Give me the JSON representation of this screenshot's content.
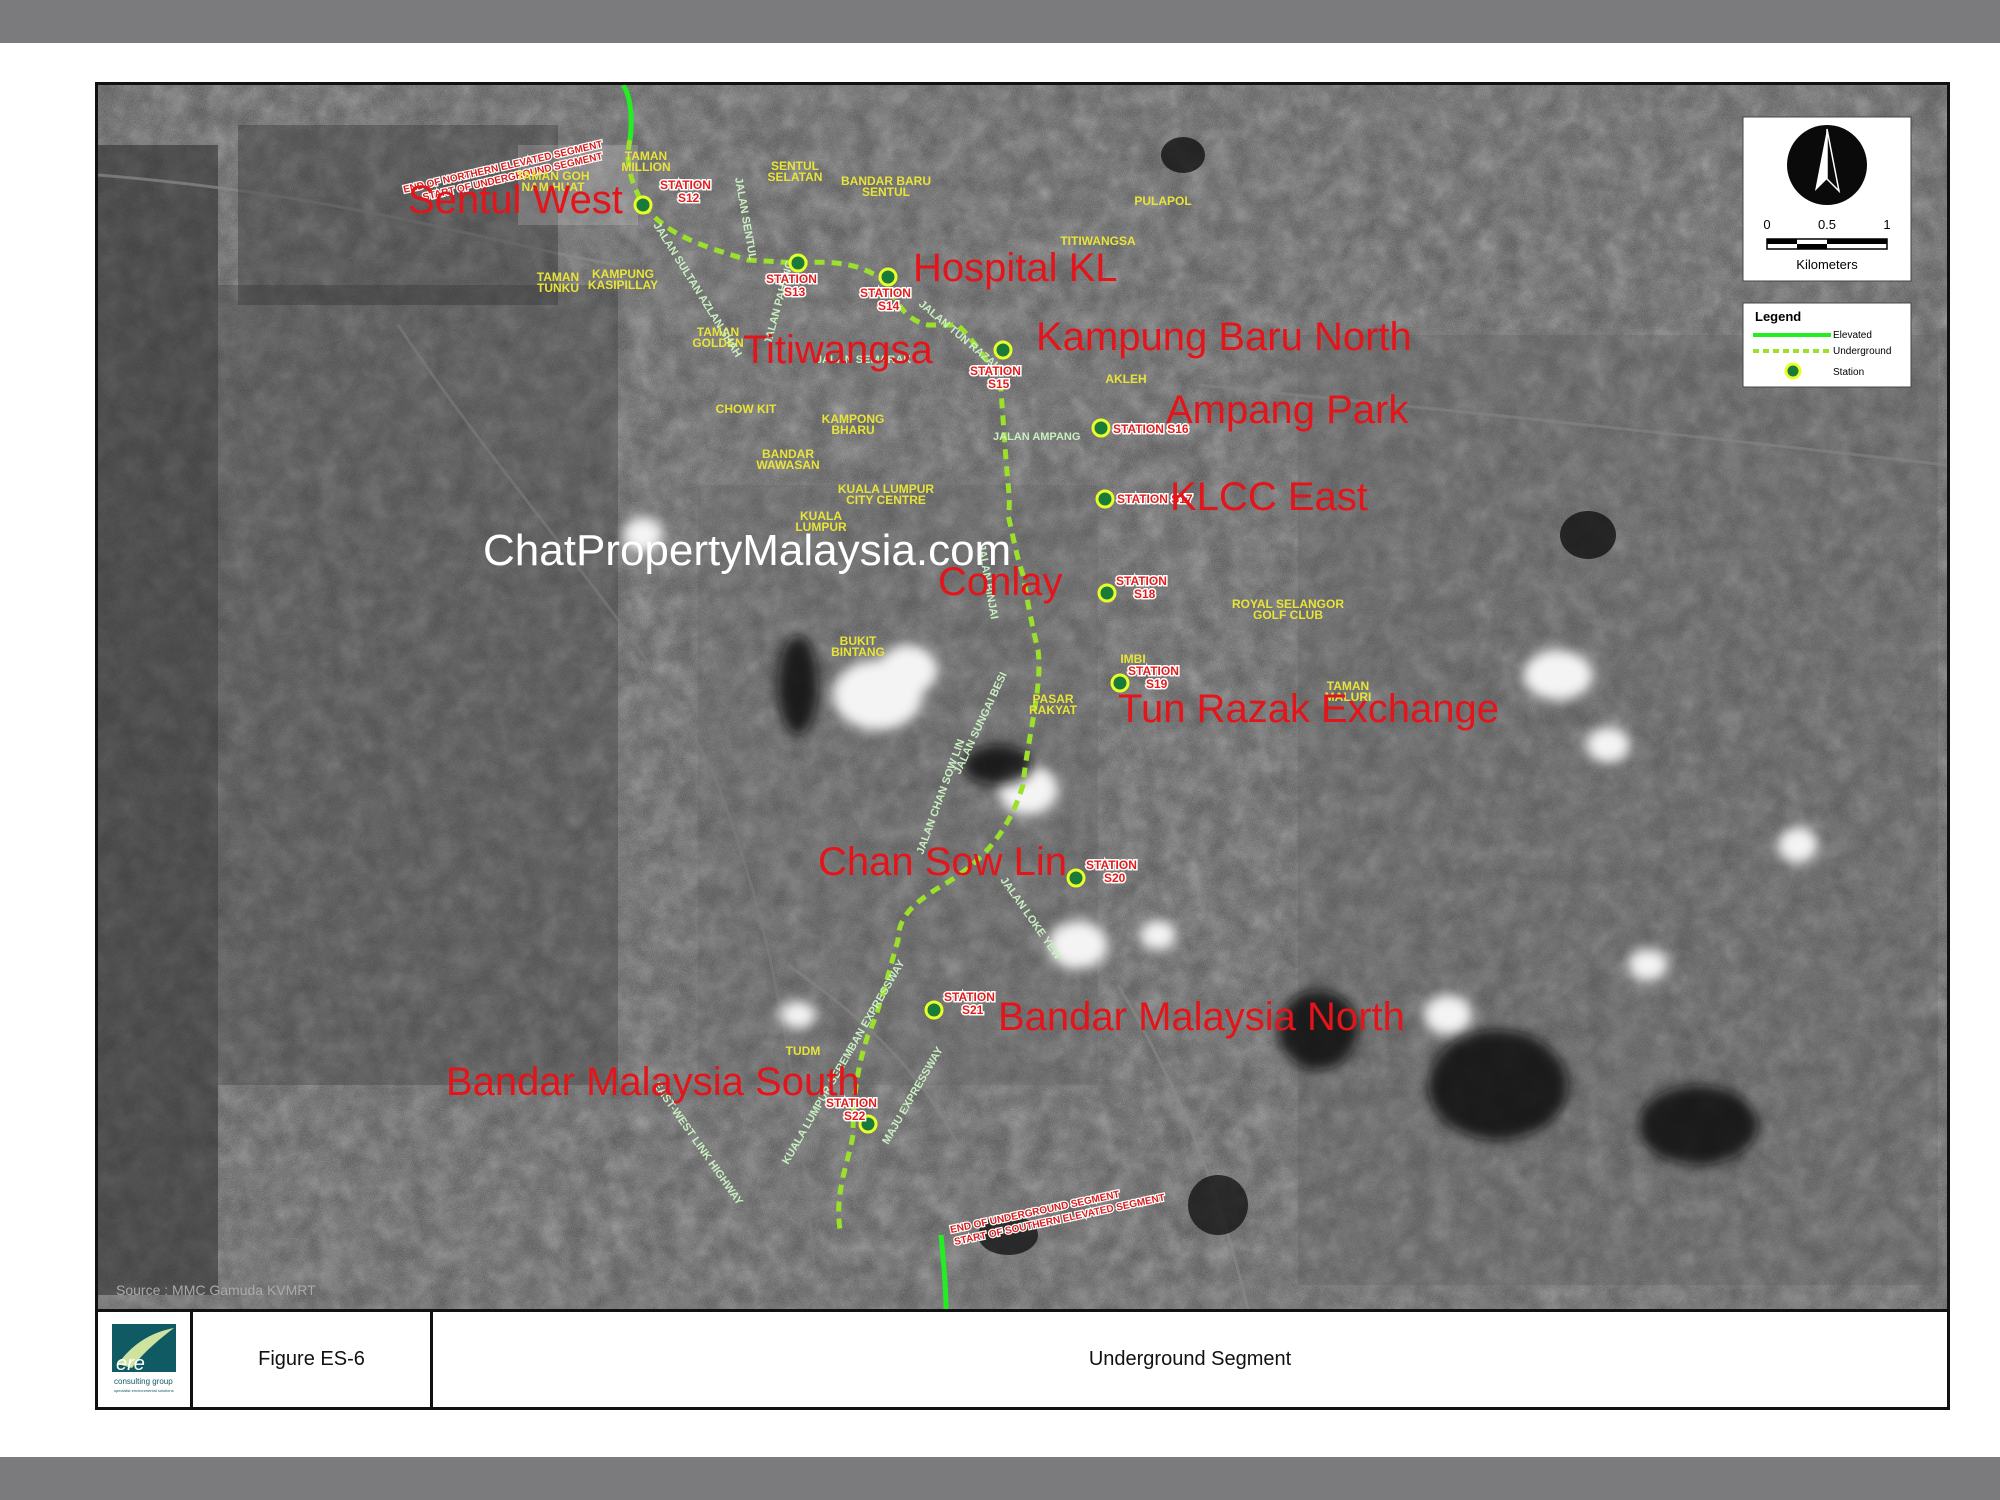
{
  "figure": {
    "number": "Figure ES-6",
    "title": "Underground Segment"
  },
  "logo": {
    "name": "ere",
    "tagline": "consulting group",
    "sub": "specialist environmental solutions"
  },
  "watermark": "ChatPropertyMalaysia.com",
  "source": "Source : MMC Gamuda KVMRT",
  "colors": {
    "elevated": "#22ee22",
    "underground": "#9be02a",
    "station_fill": "#1a7a3a",
    "station_ring": "#e8ff2a",
    "station_label": "#e31b1b",
    "area_label": "#e8e43a",
    "road_label": "#c9f0c0",
    "name_label": "#e3141a"
  },
  "north_arrow": {
    "scale_ticks": [
      "0",
      "0.5",
      "1"
    ],
    "unit": "Kilometers"
  },
  "legend": {
    "title": "Legend",
    "items": [
      {
        "label": "Elevated",
        "symbol": "solid-line"
      },
      {
        "label": "Underground",
        "symbol": "dashed-line"
      },
      {
        "label": "Station",
        "symbol": "circle"
      }
    ]
  },
  "segment_notes": {
    "north": [
      "END OF NORTHERN ELEVATED SEGMENT",
      "START OF UNDERGROUND SEGMENT"
    ],
    "south": [
      "END OF UNDERGROUND SEGMENT",
      "START OF SOUTHERN ELEVATED SEGMENT"
    ]
  },
  "stations": [
    {
      "code": "S12",
      "prefix": "STATION",
      "name": "Sentul West"
    },
    {
      "code": "S13",
      "prefix": "STATION",
      "name": "Titiwangsa"
    },
    {
      "code": "S14",
      "prefix": "STATION",
      "name": "Hospital KL"
    },
    {
      "code": "S15",
      "prefix": "STATION",
      "name": "Kampung Baru North"
    },
    {
      "code": "S16",
      "prefix": "STATION",
      "name": "Ampang Park"
    },
    {
      "code": "S17",
      "prefix": "STATION",
      "name": "KLCC East"
    },
    {
      "code": "S18",
      "prefix": "STATION",
      "name": "Conlay"
    },
    {
      "code": "S19",
      "prefix": "STATION",
      "name": "Tun Razak Exchange"
    },
    {
      "code": "S20",
      "prefix": "STATION",
      "name": "Chan Sow Lin"
    },
    {
      "code": "S21",
      "prefix": "STATION",
      "name": "Bandar Malaysia North"
    },
    {
      "code": "S22",
      "prefix": "STATION",
      "name": "Bandar Malaysia South"
    }
  ],
  "area_labels": [
    "TAMAN MILLION",
    "TAMAN GOH NAM HUAT",
    "SENTUL SELATAN",
    "BANDAR BARU SENTUL",
    "PULAPOL",
    "TITIWANGSA",
    "TAMAN TUNKU",
    "KAMPUNG KASIPILLAY",
    "TAMAN GOLDEN",
    "CHOW KIT",
    "KAMPONG BHARU",
    "BANDAR WAWASAN",
    "KUALA LUMPUR CITY CENTRE",
    "KUALA LUMPUR",
    "AKLEH",
    "ROYAL SELANGOR GOLF CLUB",
    "BUKIT BINTANG",
    "IMBI",
    "PASAR RAKYAT",
    "TAMAN MALURI",
    "TUDM"
  ],
  "road_labels": [
    "JALAN SULTAN AZLAN SHAH",
    "JALAN SENTUL",
    "JALAN TUN RAZAK",
    "JALAN PAHANG",
    "JALAN SEMARAK",
    "JALAN AMPANG",
    "JALAN BINJAI",
    "JALAN SUNGAI BESI",
    "JALAN CHAN SOW LIN",
    "JALAN LOKE YEW",
    "EAST-WEST LINK HIGHWAY",
    "KUALA LUMPUR-SEREMBAN EXPRESSWAY",
    "MAJU EXPRESSWAY"
  ]
}
